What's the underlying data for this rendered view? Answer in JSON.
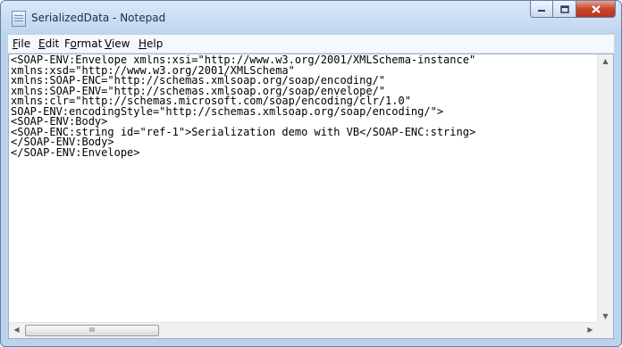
{
  "window": {
    "title": "SerializedData - Notepad",
    "icon": "notepad-icon"
  },
  "caption_buttons": {
    "minimize_icon": "minimize-icon",
    "maximize_icon": "maximize-icon",
    "close_icon": "close-icon"
  },
  "menu": {
    "items": [
      {
        "label": "File",
        "accesskey": "F",
        "rest": "ile"
      },
      {
        "label": "Edit",
        "accesskey": "E",
        "rest": "dit"
      },
      {
        "label": "Format",
        "accesskey": "o",
        "pre": "F",
        "rest": "rmat"
      },
      {
        "label": "View",
        "accesskey": "V",
        "rest": "iew"
      },
      {
        "label": "Help",
        "accesskey": "H",
        "rest": "elp"
      }
    ]
  },
  "editor": {
    "content": "<SOAP-ENV:Envelope xmlns:xsi=\"http://www.w3.org/2001/XMLSchema-instance\"\nxmlns:xsd=\"http://www.w3.org/2001/XMLSchema\"\nxmlns:SOAP-ENC=\"http://schemas.xmlsoap.org/soap/encoding/\"\nxmlns:SOAP-ENV=\"http://schemas.xmlsoap.org/soap/envelope/\"\nxmlns:clr=\"http://schemas.microsoft.com/soap/encoding/clr/1.0\"\nSOAP-ENV:encodingStyle=\"http://schemas.xmlsoap.org/soap/encoding/\">\n<SOAP-ENV:Body>\n<SOAP-ENC:string id=\"ref-1\">Serialization demo with VB</SOAP-ENC:string>\n</SOAP-ENV:Body>\n</SOAP-ENV:Envelope>"
  },
  "scrollbars": {
    "thumb_grip": "III"
  }
}
